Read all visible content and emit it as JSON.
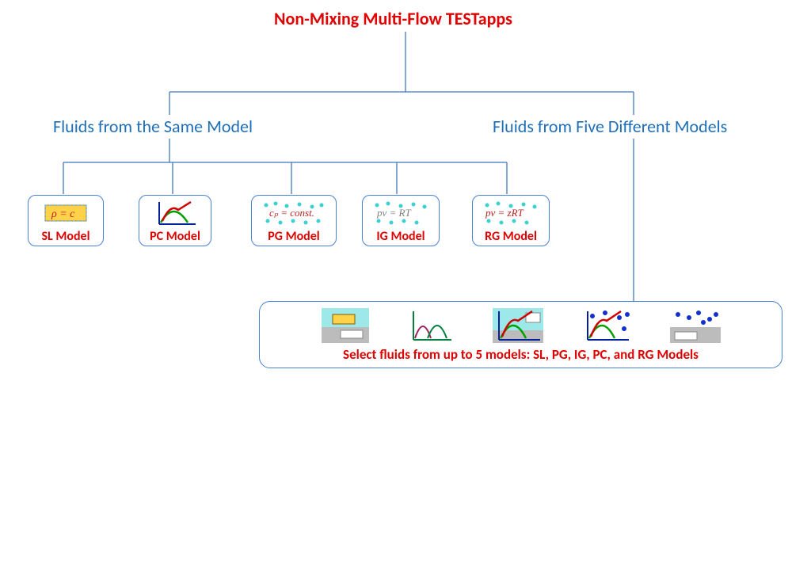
{
  "title": "Non-Mixing Multi-Flow TESTapps",
  "branches": {
    "same": "Fluids from the Same Model",
    "five": "Fluids from Five Different Models"
  },
  "models": {
    "sl": "SL Model",
    "pc": "PC Model",
    "pg": "PG Model",
    "ig": "IG Model",
    "rg": "RG Model"
  },
  "formulas": {
    "sl": "ρ = c",
    "pg": "cₚ = const.",
    "ig": "pv = RT",
    "rg": "pv = zRT"
  },
  "multi": "Select fluids from up to 5 models: SL, PG, IG, PC, and RG Models"
}
